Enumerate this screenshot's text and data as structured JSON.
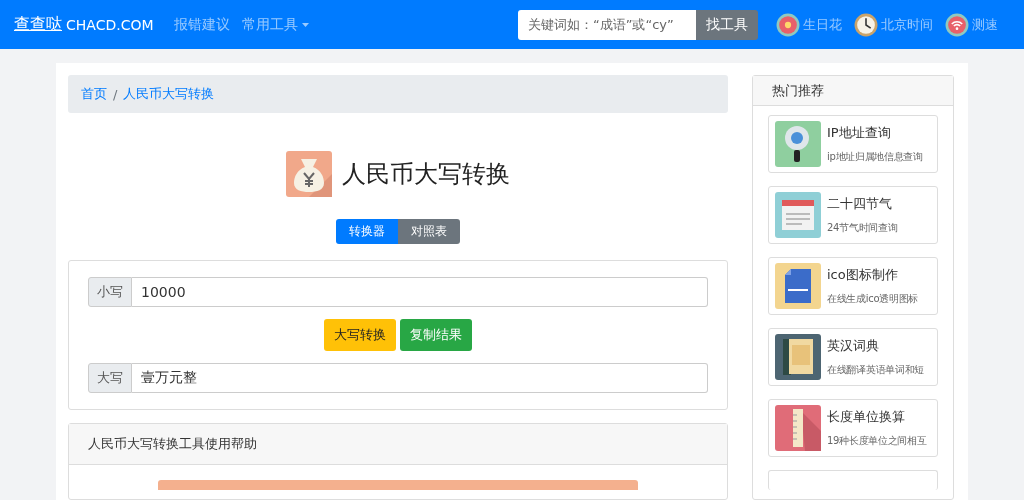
{
  "navbar": {
    "brand": "查查哒",
    "brand_domain": "CHACD.COM",
    "links": [
      {
        "label": "报错建议",
        "kind": "link"
      },
      {
        "label": "常用工具",
        "kind": "dropdown"
      }
    ],
    "search": {
      "placeholder": "关键词如：“成语”或“cy”",
      "button": "找工具"
    },
    "shortcuts": [
      {
        "label": "生日花",
        "kind": "flower"
      },
      {
        "label": "北京时间",
        "kind": "clock"
      },
      {
        "label": "测速",
        "kind": "wifi"
      }
    ]
  },
  "breadcrumb": {
    "separator": "/",
    "items": [
      {
        "label": "首页"
      },
      {
        "label": "人民币大写转换"
      }
    ]
  },
  "title": "人民币大写转换",
  "tabs": [
    {
      "label": "转换器",
      "selected": true
    },
    {
      "label": "对照表",
      "selected": false
    }
  ],
  "converter": {
    "input_label": "小写",
    "input_value": "10000",
    "buttons": [
      {
        "label": "大写转换",
        "kind": "warning"
      },
      {
        "label": "复制结果",
        "kind": "success"
      }
    ],
    "output_label": "大写",
    "output_value": "壹万元整"
  },
  "help": {
    "title": "人民币大写转换工具使用帮助"
  },
  "sidebar": {
    "title": "热门推荐",
    "items": [
      {
        "title": "IP地址查询",
        "desc": "ip地址归属地信息查询",
        "kind": "ip"
      },
      {
        "title": "二十四节气",
        "desc": "24节气时间查询",
        "kind": "calendar"
      },
      {
        "title": "ico图标制作",
        "desc": "在线生成ico透明图标",
        "kind": "ico"
      },
      {
        "title": "英汉词典",
        "desc": "在线翻译英语单词和短",
        "kind": "dict"
      },
      {
        "title": "长度单位换算",
        "desc": "19种长度单位之间相互",
        "kind": "ruler"
      }
    ]
  }
}
